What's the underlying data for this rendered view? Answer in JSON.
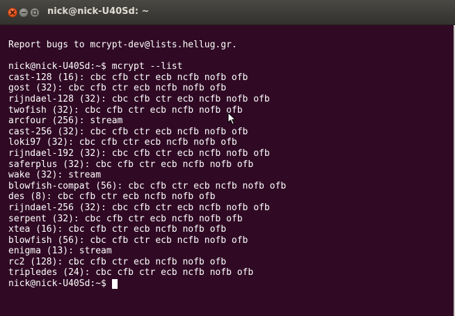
{
  "window": {
    "title": "nick@nick-U40Sd: ~"
  },
  "colors": {
    "terminal_background": "#300a24",
    "terminal_text": "#ffffff",
    "close_button": "#e95420",
    "titlebar": "#3c3b37"
  },
  "terminal": {
    "lines": [
      "Report bugs to mcrypt-dev@lists.hellug.gr.",
      "",
      "nick@nick-U40Sd:~$ mcrypt --list",
      "cast-128 (16): cbc cfb ctr ecb ncfb nofb ofb",
      "gost (32): cbc cfb ctr ecb ncfb nofb ofb",
      "rijndael-128 (32): cbc cfb ctr ecb ncfb nofb ofb",
      "twofish (32): cbc cfb ctr ecb ncfb nofb ofb",
      "arcfour (256): stream",
      "cast-256 (32): cbc cfb ctr ecb ncfb nofb ofb",
      "loki97 (32): cbc cfb ctr ecb ncfb nofb ofb",
      "rijndael-192 (32): cbc cfb ctr ecb ncfb nofb ofb",
      "saferplus (32): cbc cfb ctr ecb ncfb nofb ofb",
      "wake (32): stream",
      "blowfish-compat (56): cbc cfb ctr ecb ncfb nofb ofb",
      "des (8): cbc cfb ctr ecb ncfb nofb ofb",
      "rijndael-256 (32): cbc cfb ctr ecb ncfb nofb ofb",
      "serpent (32): cbc cfb ctr ecb ncfb nofb ofb",
      "xtea (16): cbc cfb ctr ecb ncfb nofb ofb",
      "blowfish (56): cbc cfb ctr ecb ncfb nofb ofb",
      "enigma (13): stream",
      "rc2 (128): cbc cfb ctr ecb ncfb nofb ofb",
      "tripledes (24): cbc cfb ctr ecb ncfb nofb ofb"
    ],
    "prompt": "nick@nick-U40Sd:~$ "
  },
  "icons": {
    "close": "close-icon",
    "minimize": "minimize-icon",
    "maximize": "maximize-icon",
    "pointer": "mouse-pointer-icon"
  }
}
